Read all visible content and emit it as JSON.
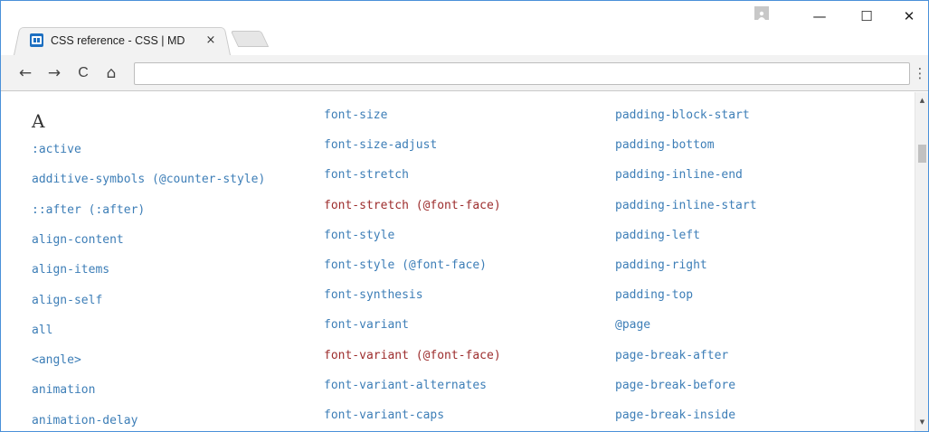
{
  "tab": {
    "title": "CSS reference - CSS | MD",
    "close_label": "×",
    "favicon_icon": "mdn-favicon-icon"
  },
  "window_controls": {
    "minimize_label": "—",
    "maximize_label": "☐",
    "close_label": "✕"
  },
  "toolbar": {
    "back_label": "←",
    "forward_label": "→",
    "reload_label": "C",
    "home_label": "⌂",
    "omnibox_value": "",
    "menu_label": "⋮"
  },
  "content": {
    "section_letter": "A",
    "col1": [
      ":active",
      "additive-symbols (@counter-style)",
      "::after (:after)",
      "align-content",
      "align-items",
      "align-self",
      "all",
      "<angle>",
      "animation",
      "animation-delay"
    ],
    "col2": [
      {
        "text": "font-size",
        "missing": false
      },
      {
        "text": "font-size-adjust",
        "missing": false
      },
      {
        "text": "font-stretch",
        "missing": false
      },
      {
        "text": "font-stretch (@font-face)",
        "missing": true
      },
      {
        "text": "font-style",
        "missing": false
      },
      {
        "text": "font-style (@font-face)",
        "missing": false
      },
      {
        "text": "font-synthesis",
        "missing": false
      },
      {
        "text": "font-variant",
        "missing": false
      },
      {
        "text": "font-variant (@font-face)",
        "missing": true
      },
      {
        "text": "font-variant-alternates",
        "missing": false
      },
      {
        "text": "font-variant-caps",
        "missing": false
      }
    ],
    "col3": [
      "padding-block-start",
      "padding-bottom",
      "padding-inline-end",
      "padding-inline-start",
      "padding-left",
      "padding-right",
      "padding-top",
      "@page",
      "page-break-after",
      "page-break-before",
      "page-break-inside"
    ]
  },
  "colors": {
    "link": "#3d7eb7",
    "missing_link": "#9d2d2d",
    "window_border": "#4a90d9"
  }
}
